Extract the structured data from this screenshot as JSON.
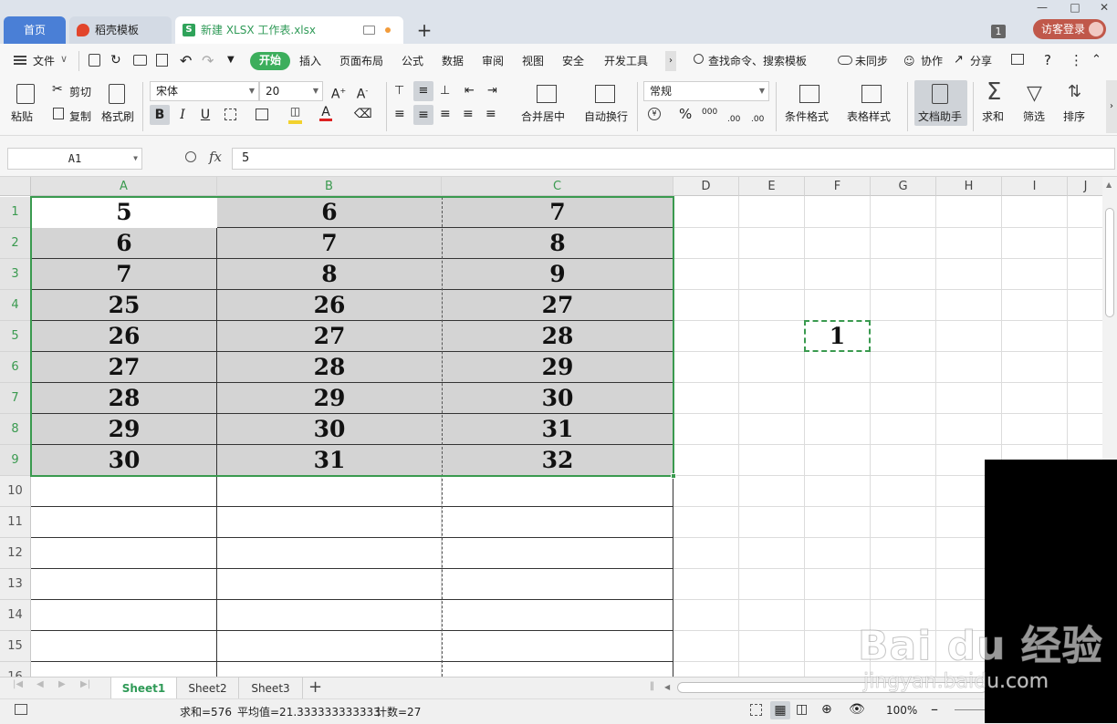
{
  "tabs": {
    "home": "首页",
    "daoke": "稻壳模板",
    "file": "新建 XLSX 工作表.xlsx",
    "new_tab": "+",
    "window_count": "1",
    "guest_login": "访客登录"
  },
  "menu": {
    "file": "文件",
    "start": "开始",
    "insert": "插入",
    "page_layout": "页面布局",
    "formula": "公式",
    "data": "数据",
    "review": "审阅",
    "view": "视图",
    "security": "安全",
    "developer": "开发工具",
    "search": "查找命令、搜索模板",
    "sync": "未同步",
    "collab": "协作",
    "share": "分享",
    "help": "?"
  },
  "ribbon": {
    "paste": "粘贴",
    "cut": "剪切",
    "copy": "复制",
    "format_painter": "格式刷",
    "font_name": "宋体",
    "font_size": "20",
    "bold": "B",
    "italic": "I",
    "underline": "U",
    "font_color_letter": "A",
    "merge_center": "合并居中",
    "auto_wrap": "自动换行",
    "number_format": "常规",
    "percent": "%",
    "thousands": "000",
    "dec_inc": ".00",
    "dec_dec": ".00",
    "conditional_format": "条件格式",
    "table_style": "表格样式",
    "doc_assistant": "文档助手",
    "sum": "求和",
    "filter": "筛选",
    "sort": "排序"
  },
  "formula_bar": {
    "name_box": "A1",
    "fx_label": "fx",
    "content": "5"
  },
  "grid": {
    "columns": [
      "A",
      "B",
      "C",
      "D",
      "E",
      "F",
      "G",
      "H",
      "I",
      "J"
    ],
    "rows": [
      "1",
      "2",
      "3",
      "4",
      "5",
      "6",
      "7",
      "8",
      "9",
      "10",
      "11",
      "12",
      "13",
      "14",
      "15",
      "16"
    ],
    "data": [
      [
        "5",
        "6",
        "7"
      ],
      [
        "6",
        "7",
        "8"
      ],
      [
        "7",
        "8",
        "9"
      ],
      [
        "25",
        "26",
        "27"
      ],
      [
        "26",
        "27",
        "28"
      ],
      [
        "27",
        "28",
        "29"
      ],
      [
        "28",
        "29",
        "30"
      ],
      [
        "29",
        "30",
        "31"
      ],
      [
        "30",
        "31",
        "32"
      ]
    ],
    "f5_value": "1",
    "selection": "A1:C9",
    "copied_cell": "F5"
  },
  "sheets": {
    "tabs": [
      "Sheet1",
      "Sheet2",
      "Sheet3"
    ],
    "active": "Sheet1",
    "add": "+"
  },
  "status": {
    "sum": "求和=576",
    "average": "平均值=21.333333333333",
    "count": "计数=27",
    "zoom": "100%"
  },
  "watermark": {
    "brand": "Bai du 经验",
    "url": "jingyan.baidu.com"
  },
  "colors": {
    "accent_green": "#3cae5c",
    "selection_green": "#3a9a4f",
    "home_tab_blue": "#4a7fd6",
    "guest_red": "#c0584a",
    "selection_fill": "#d4d4d4"
  }
}
